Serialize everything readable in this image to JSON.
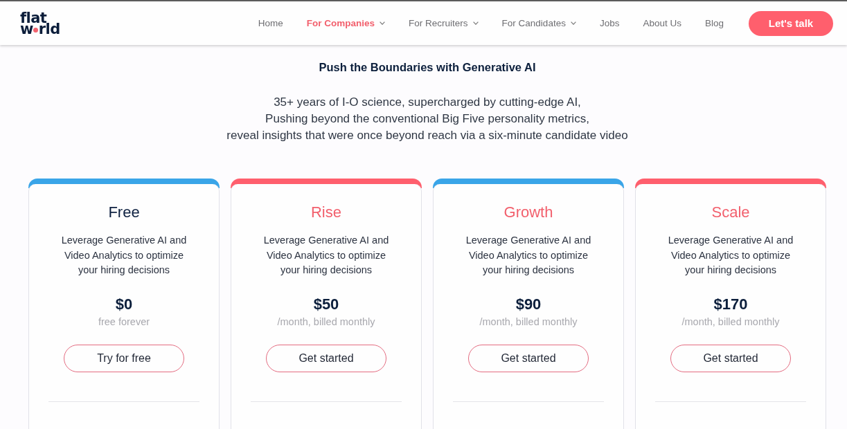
{
  "header": {
    "logo": {
      "line_1": "flat",
      "line_2_start": "w",
      "line_2_end": "rld"
    },
    "nav": [
      {
        "label": "Home",
        "selected": false,
        "has_menu": false
      },
      {
        "label": "For Companies",
        "selected": true,
        "has_menu": true
      },
      {
        "label": "For Recruiters",
        "selected": false,
        "has_menu": true
      },
      {
        "label": "For Candidates",
        "selected": false,
        "has_menu": true
      },
      {
        "label": "Jobs",
        "selected": false,
        "has_menu": false
      },
      {
        "label": "About Us",
        "selected": false,
        "has_menu": false
      },
      {
        "label": "Blog",
        "selected": false,
        "has_menu": false
      }
    ],
    "cta": {
      "label": "Let's talk"
    }
  },
  "hero": {
    "title": "Push the Boundaries with Generative AI",
    "text": "35+ years of I-O science, supercharged by cutting-edge AI,\nPushing beyond the conventional Big Five personality metrics,\nreveal insights that were once beyond reach via a six-minute candidate video"
  },
  "plans": [
    {
      "name": "Free",
      "color": "#3aa5e8",
      "title_highlighted": false,
      "description": "Leverage Generative AI and Video Analytics to optimize your hiring decisions",
      "price": "$0",
      "billing": "free forever",
      "button": "Try for free"
    },
    {
      "name": "Rise",
      "color": "#ff5f6d",
      "title_highlighted": true,
      "description": "Leverage Generative AI and Video Analytics to optimize your hiring decisions",
      "price": "$50",
      "billing": "/month, billed monthly",
      "button": "Get started"
    },
    {
      "name": "Growth",
      "color": "#3aa5e8",
      "title_highlighted": true,
      "description": "Leverage Generative AI and Video Analytics to optimize your hiring decisions",
      "price": "$90",
      "billing": "/month, billed monthly",
      "button": "Get started"
    },
    {
      "name": "Scale",
      "color": "#ff5f6d",
      "title_highlighted": true,
      "description": "Leverage Generative AI and Video Analytics to optimize your hiring decisions",
      "price": "$170",
      "billing": "/month, billed monthly",
      "button": "Get started"
    }
  ]
}
